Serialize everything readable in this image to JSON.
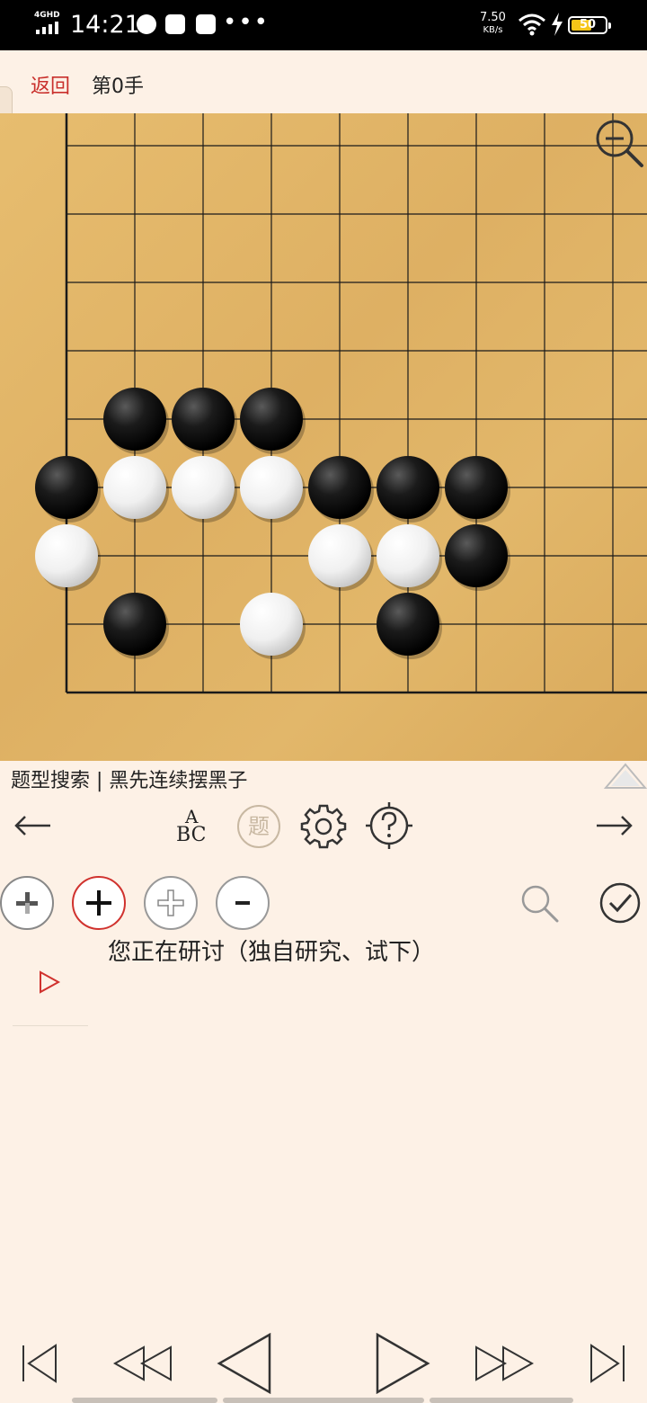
{
  "status_bar": {
    "network": "4GHD",
    "time": "14:21",
    "speed": "7.50",
    "speed_unit": "KB/s",
    "battery": "50",
    "battery_color": "#f5c518"
  },
  "header": {
    "back_label": "返回",
    "move_label": "第0手",
    "back_color": "#c9302c"
  },
  "board": {
    "grid_lines": 9,
    "black_stones": [
      [
        2,
        5
      ],
      [
        3,
        5
      ],
      [
        4,
        5
      ],
      [
        1,
        6
      ],
      [
        5,
        6
      ],
      [
        6,
        6
      ],
      [
        7,
        6
      ],
      [
        7,
        7
      ],
      [
        2,
        8
      ],
      [
        6,
        8
      ]
    ],
    "white_stones": [
      [
        2,
        6
      ],
      [
        3,
        6
      ],
      [
        4,
        6
      ],
      [
        1,
        7
      ],
      [
        5,
        7
      ],
      [
        6,
        7
      ],
      [
        4,
        8
      ]
    ]
  },
  "problem": {
    "title": "题型搜索 | 黑先连续摆黑子"
  },
  "toolbar": {
    "abc_top": "A",
    "abc_bottom": "BC",
    "ti_label": "题",
    "icons": [
      "prev-arrow-icon",
      "abc-label-icon",
      "problem-icon",
      "gear-icon",
      "help-icon",
      "next-arrow-icon"
    ]
  },
  "edit_row": {
    "icons": [
      "add-alternate-icon",
      "add-black-icon",
      "add-white-icon",
      "remove-stone-icon",
      "search-icon",
      "check-icon"
    ]
  },
  "discussion": {
    "text": "您正在研讨（独自研究、试下）"
  },
  "nav": {
    "icons": [
      "first-move-icon",
      "fast-back-icon",
      "back-icon",
      "forward-icon",
      "fast-forward-icon",
      "last-move-icon"
    ]
  }
}
